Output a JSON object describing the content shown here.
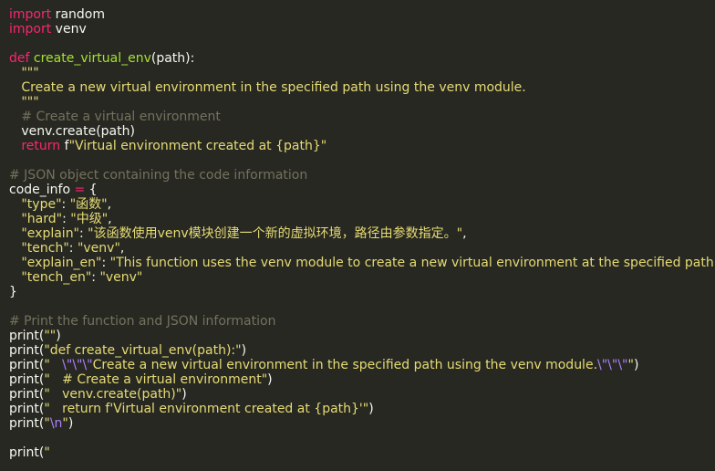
{
  "editor": {
    "colors": {
      "background": "#272822",
      "keyword": "#f92672",
      "function": "#a6e22e",
      "string": "#e6db74",
      "comment": "#75715e",
      "text": "#f8f8f2",
      "escape": "#ae81ff"
    },
    "lines": [
      [
        {
          "t": "import",
          "c": "keyword"
        },
        {
          "t": " random",
          "c": "text"
        }
      ],
      [
        {
          "t": "import",
          "c": "keyword"
        },
        {
          "t": " venv",
          "c": "text"
        }
      ],
      [],
      [
        {
          "t": "def ",
          "c": "keyword"
        },
        {
          "t": "create_virtual_env",
          "c": "function"
        },
        {
          "t": "(path):",
          "c": "text"
        }
      ],
      [
        {
          "t": "   \"\"\"",
          "c": "string"
        }
      ],
      [
        {
          "t": "   Create a new virtual environment in the specified path using the venv module.",
          "c": "string"
        }
      ],
      [
        {
          "t": "   \"\"\"",
          "c": "string"
        }
      ],
      [
        {
          "t": "   # Create a virtual environment",
          "c": "comment"
        }
      ],
      [
        {
          "t": "   venv.create(path)",
          "c": "text"
        }
      ],
      [
        {
          "t": "   ",
          "c": "text"
        },
        {
          "t": "return ",
          "c": "keyword"
        },
        {
          "t": "f",
          "c": "text"
        },
        {
          "t": "\"Virtual environment created at {path}\"",
          "c": "string"
        }
      ],
      [],
      [
        {
          "t": "# JSON object containing the code information",
          "c": "comment"
        }
      ],
      [
        {
          "t": "code_info ",
          "c": "text"
        },
        {
          "t": "=",
          "c": "keyword"
        },
        {
          "t": " {",
          "c": "text"
        }
      ],
      [
        {
          "t": "   \"type\"",
          "c": "string"
        },
        {
          "t": ": ",
          "c": "text"
        },
        {
          "t": "\"函数\"",
          "c": "string"
        },
        {
          "t": ",",
          "c": "text"
        }
      ],
      [
        {
          "t": "   \"hard\"",
          "c": "string"
        },
        {
          "t": ": ",
          "c": "text"
        },
        {
          "t": "\"中级\"",
          "c": "string"
        },
        {
          "t": ",",
          "c": "text"
        }
      ],
      [
        {
          "t": "   \"explain\"",
          "c": "string"
        },
        {
          "t": ": ",
          "c": "text"
        },
        {
          "t": "\"该函数使用venv模块创建一个新的虚拟环境，路径由参数指定。\"",
          "c": "string"
        },
        {
          "t": ",",
          "c": "text"
        }
      ],
      [
        {
          "t": "   \"tench\"",
          "c": "string"
        },
        {
          "t": ": ",
          "c": "text"
        },
        {
          "t": "\"venv\"",
          "c": "string"
        },
        {
          "t": ",",
          "c": "text"
        }
      ],
      [
        {
          "t": "   \"explain_en\"",
          "c": "string"
        },
        {
          "t": ": ",
          "c": "text"
        },
        {
          "t": "\"This function uses the venv module to create a new virtual environment at the specified path.\"",
          "c": "string"
        },
        {
          "t": ",",
          "c": "text"
        }
      ],
      [
        {
          "t": "   \"tench_en\"",
          "c": "string"
        },
        {
          "t": ": ",
          "c": "text"
        },
        {
          "t": "\"venv\"",
          "c": "string"
        }
      ],
      [
        {
          "t": "}",
          "c": "text"
        }
      ],
      [],
      [
        {
          "t": "# Print the function and JSON information",
          "c": "comment"
        }
      ],
      [
        {
          "t": "print(",
          "c": "text"
        },
        {
          "t": "\"\"",
          "c": "string"
        },
        {
          "t": ")",
          "c": "text"
        }
      ],
      [
        {
          "t": "print(",
          "c": "text"
        },
        {
          "t": "\"def create_virtual_env(path):\"",
          "c": "string"
        },
        {
          "t": ")",
          "c": "text"
        }
      ],
      [
        {
          "t": "print(",
          "c": "text"
        },
        {
          "t": "\"   ",
          "c": "string"
        },
        {
          "t": "\\\"\\\"\\\"",
          "c": "escape"
        },
        {
          "t": "Create a new virtual environment in the specified path using the venv module.",
          "c": "string"
        },
        {
          "t": "\\\"\\\"\\\"",
          "c": "escape"
        },
        {
          "t": "\"",
          "c": "string"
        },
        {
          "t": ")",
          "c": "text"
        }
      ],
      [
        {
          "t": "print(",
          "c": "text"
        },
        {
          "t": "\"   # Create a virtual environment\"",
          "c": "string"
        },
        {
          "t": ")",
          "c": "text"
        }
      ],
      [
        {
          "t": "print(",
          "c": "text"
        },
        {
          "t": "\"   venv.create(path)\"",
          "c": "string"
        },
        {
          "t": ")",
          "c": "text"
        }
      ],
      [
        {
          "t": "print(",
          "c": "text"
        },
        {
          "t": "\"   return f'Virtual environment created at {path}'\"",
          "c": "string"
        },
        {
          "t": ")",
          "c": "text"
        }
      ],
      [
        {
          "t": "print(",
          "c": "text"
        },
        {
          "t": "\"",
          "c": "string"
        },
        {
          "t": "\\n",
          "c": "escape"
        },
        {
          "t": "\"",
          "c": "string"
        },
        {
          "t": ")",
          "c": "text"
        }
      ],
      [],
      [
        {
          "t": "print(",
          "c": "text"
        },
        {
          "t": "\"",
          "c": "string"
        }
      ]
    ]
  }
}
